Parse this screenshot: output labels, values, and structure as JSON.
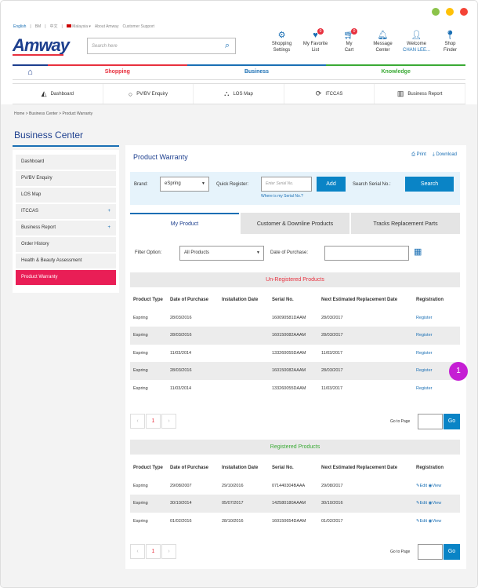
{
  "window": {
    "colors": [
      "#8bc34a",
      "#ffc107",
      "#f44336"
    ]
  },
  "topbar": {
    "lang_active": "English",
    "lang_bm": "BM",
    "lang_cn": "中文",
    "country": "Malaysia",
    "about": "About Amway",
    "support": "Customer Support"
  },
  "logo": "Amway",
  "search": {
    "placeholder": "Search here"
  },
  "header_icons": [
    {
      "icon": "gear-icon",
      "label": "Shopping",
      "label2": "Settings"
    },
    {
      "icon": "heart-icon",
      "label": "My Favorite",
      "label2": "List",
      "badge": "0"
    },
    {
      "icon": "cart-icon",
      "label": "My",
      "label2": "Cart",
      "badge": "0"
    },
    {
      "icon": "bell-icon",
      "label": "Message",
      "label2": "Center"
    },
    {
      "icon": "user-icon",
      "label": "Welcome",
      "label2": "CHAN LEE..."
    },
    {
      "icon": "location-icon",
      "label": "Shop",
      "label2": "Finder"
    }
  ],
  "nav": {
    "home_icon": "home-icon",
    "items": [
      {
        "label": "Shopping",
        "color": "#e8303e"
      },
      {
        "label": "Business",
        "color": "#1a6fb4"
      },
      {
        "label": "Knowledge",
        "color": "#3aaa35"
      }
    ]
  },
  "subnav": [
    {
      "icon": "dashboard-icon",
      "label": "Dashboard"
    },
    {
      "icon": "circle-icon",
      "label": "PV/BV Enquiry"
    },
    {
      "icon": "los-map-icon",
      "label": "LOS Map"
    },
    {
      "icon": "refresh-icon",
      "label": "ITCCAS"
    },
    {
      "icon": "bar-chart-icon",
      "label": "Business Report"
    }
  ],
  "breadcrumb": {
    "home": "Home",
    "l1": "Business Center",
    "l2": "Product Warranty",
    "sep": ">"
  },
  "page_title": "Business Center",
  "sidebar": [
    {
      "label": "Dashboard",
      "plus": ""
    },
    {
      "label": "PV/BV Enquiry",
      "plus": ""
    },
    {
      "label": "LOS Map",
      "plus": ""
    },
    {
      "label": "ITCCAS",
      "plus": "+"
    },
    {
      "label": "Business Report",
      "plus": "+"
    },
    {
      "label": "Order History",
      "plus": ""
    },
    {
      "label": "Health & Beauty Assessment",
      "plus": ""
    },
    {
      "label": "Product Warranty",
      "plus": "",
      "active": true
    }
  ],
  "main": {
    "title": "Product Warranty",
    "print": "Print",
    "download": "Download",
    "brand_label": "Brand:",
    "brand_value": "eSpring",
    "quick_label": "Quick Register:",
    "serial_placeholder": "Enter Serial No.",
    "add": "Add",
    "where_link": "Where is my Serial No.?",
    "search_serial_label": "Search Serial No.:",
    "search_btn": "Search",
    "tabs": [
      "My Product",
      "Customer & Downline Products",
      "Tracks Replacement Parts"
    ],
    "filter_label": "Filter Option:",
    "filter_value": "All Products",
    "date_label": "Date of Purchase:",
    "unreg_title": "Un-Registered Products",
    "unreg_color": "#e8303e",
    "unreg_headers": [
      "Product Type",
      "Date of Purchase",
      "Installation Date",
      "Serial No.",
      "Next Estimated Replacement Date",
      "Registration"
    ],
    "unreg_rows": [
      [
        "Espring",
        "28/03/2016",
        "",
        "160090581DAAM",
        "28/03/2017",
        "Register"
      ],
      [
        "Espring",
        "28/03/2016",
        "",
        "160150082AAAM",
        "28/03/2017",
        "Register"
      ],
      [
        "Espring",
        "11/03/2014",
        "",
        "133260055DAAM",
        "11/03/2017",
        "Register"
      ],
      [
        "Espring",
        "28/03/2016",
        "",
        "160150082AAAM",
        "28/03/2017",
        "Register"
      ],
      [
        "Espring",
        "11/03/2014",
        "",
        "133260055DAAM",
        "11/03/2017",
        "Register"
      ]
    ],
    "page": "1",
    "goto": "Go to Page",
    "go": "Go",
    "reg_title": "Registered Products",
    "reg_color": "#3aaa35",
    "reg_headers": [
      "Product Type",
      "Date of Purchase",
      "Installation Date",
      "Serial No.",
      "Next Estimated Replacement Date",
      "Registration"
    ],
    "reg_rows": [
      [
        "Espring",
        "29/08/2007",
        "29/10/2016",
        "071440304BAAA",
        "29/08/2017"
      ],
      [
        "Espring",
        "30/10/2014",
        "05/07/2017",
        "142580180AAAM",
        "30/10/2016"
      ],
      [
        "Espring",
        "01/02/2016",
        "28/10/2016",
        "160150654DAAM",
        "01/02/2017"
      ]
    ],
    "edit": "Edit",
    "view": "View"
  },
  "marker": "1"
}
